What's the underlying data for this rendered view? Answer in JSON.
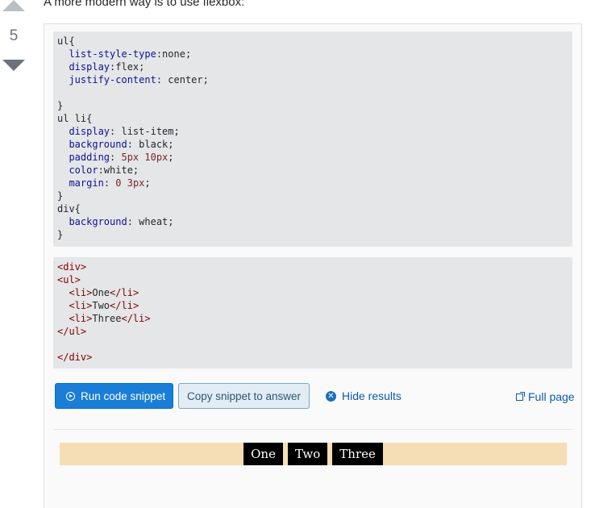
{
  "vote": {
    "score": "5"
  },
  "answer": {
    "intro": "A more modern way is to use flexbox:"
  },
  "snippet": {
    "css_lines": [
      [
        [
          "plain",
          "ul{"
        ]
      ],
      [
        [
          "plain",
          "  "
        ],
        [
          "prop",
          "list-style-type"
        ],
        [
          "plain",
          ":none;"
        ]
      ],
      [
        [
          "plain",
          "  "
        ],
        [
          "prop",
          "display"
        ],
        [
          "plain",
          ":flex;"
        ]
      ],
      [
        [
          "plain",
          "  "
        ],
        [
          "prop",
          "justify-content"
        ],
        [
          "plain",
          ": center;"
        ]
      ],
      [
        [
          "plain",
          ""
        ]
      ],
      [
        [
          "plain",
          "}"
        ]
      ],
      [
        [
          "plain",
          "ul li{"
        ]
      ],
      [
        [
          "plain",
          "  "
        ],
        [
          "prop",
          "display"
        ],
        [
          "plain",
          ": list-item;"
        ]
      ],
      [
        [
          "plain",
          "  "
        ],
        [
          "prop",
          "background"
        ],
        [
          "plain",
          ": black;"
        ]
      ],
      [
        [
          "plain",
          "  "
        ],
        [
          "prop",
          "padding"
        ],
        [
          "plain",
          ": "
        ],
        [
          "num",
          "5px 10px"
        ],
        [
          "plain",
          ";"
        ]
      ],
      [
        [
          "plain",
          "  "
        ],
        [
          "prop",
          "color"
        ],
        [
          "plain",
          ":white;"
        ]
      ],
      [
        [
          "plain",
          "  "
        ],
        [
          "prop",
          "margin"
        ],
        [
          "plain",
          ": "
        ],
        [
          "num",
          "0 3px"
        ],
        [
          "plain",
          ";"
        ]
      ],
      [
        [
          "plain",
          "}"
        ]
      ],
      [
        [
          "plain",
          "div{"
        ]
      ],
      [
        [
          "plain",
          "  "
        ],
        [
          "prop",
          "background"
        ],
        [
          "plain",
          ": wheat;"
        ]
      ],
      [
        [
          "plain",
          "}"
        ]
      ]
    ],
    "html_lines": [
      [
        [
          "tag",
          "<div>"
        ]
      ],
      [
        [
          "tag",
          "<ul>"
        ]
      ],
      [
        [
          "plain",
          "  "
        ],
        [
          "tag",
          "<li>"
        ],
        [
          "plain",
          "One"
        ],
        [
          "tag",
          "</li>"
        ]
      ],
      [
        [
          "plain",
          "  "
        ],
        [
          "tag",
          "<li>"
        ],
        [
          "plain",
          "Two"
        ],
        [
          "tag",
          "</li>"
        ]
      ],
      [
        [
          "plain",
          "  "
        ],
        [
          "tag",
          "<li>"
        ],
        [
          "plain",
          "Three"
        ],
        [
          "tag",
          "</li>"
        ]
      ],
      [
        [
          "tag",
          "</ul>"
        ]
      ],
      [
        [
          "plain",
          ""
        ]
      ],
      [
        [
          "tag",
          "</div>"
        ]
      ]
    ],
    "run_label": "Run code snippet",
    "copy_label": "Copy snippet to answer",
    "hide_label": "Hide results",
    "full_label": "Full page",
    "result_items": [
      "One",
      "Two",
      "Three"
    ]
  },
  "colors": {
    "run_button": "#1a7ed6",
    "link": "#0c5ba8",
    "code_bg": "#e4e6e8",
    "result_bg": "#f5deb3"
  },
  "icons": {
    "upvote": "triangle-up-icon",
    "downvote": "triangle-down-icon",
    "run": "play-circle-icon",
    "hide": "close-circle-icon",
    "full": "external-link-icon"
  }
}
